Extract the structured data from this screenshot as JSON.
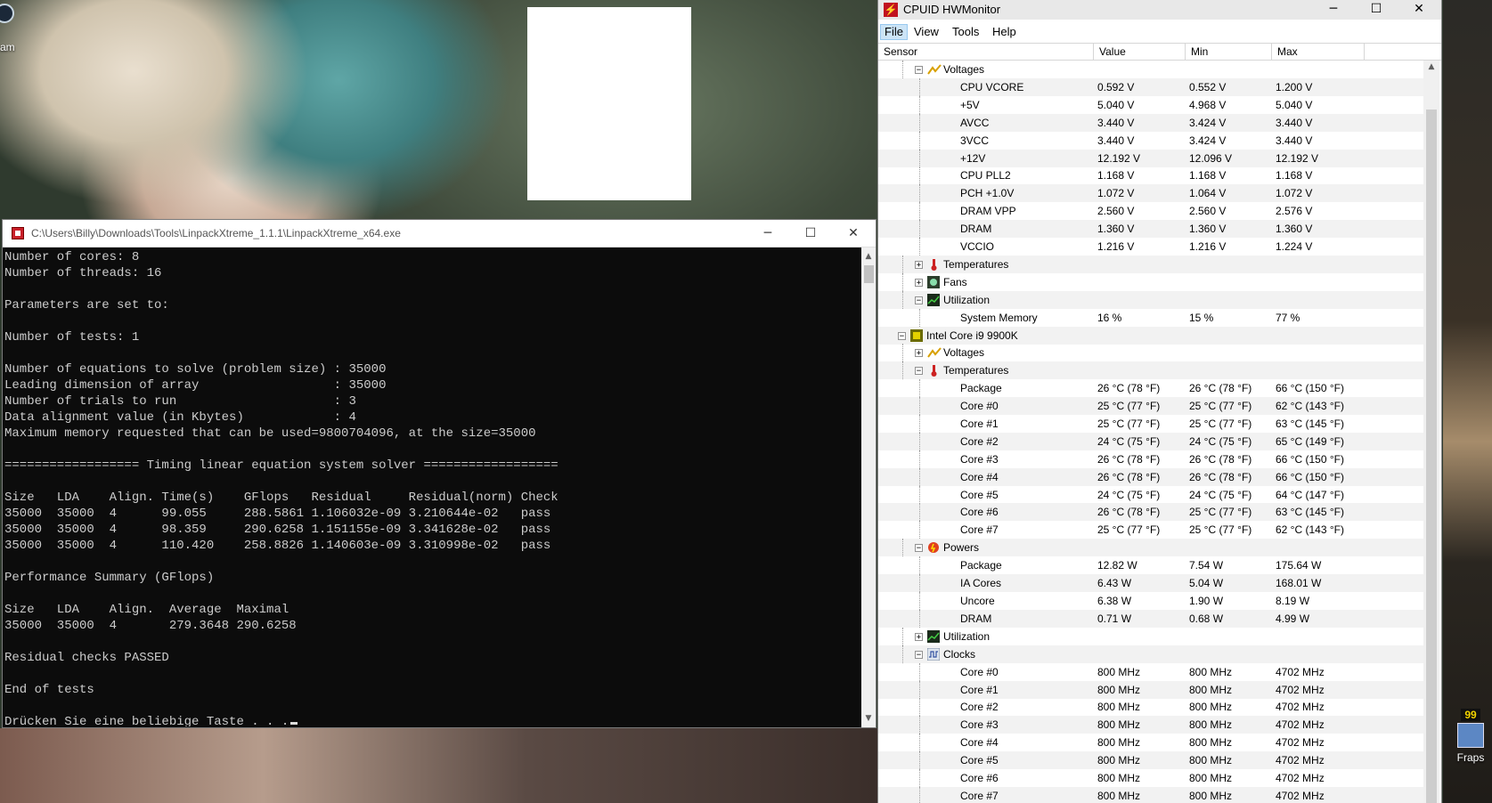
{
  "desktop": {
    "steam_label": "am",
    "fraps_label": "Fraps",
    "fraps_badge": "99"
  },
  "console": {
    "title": "C:\\Users\\Billy\\Downloads\\Tools\\LinpackXtreme_1.1.1\\LinpackXtreme_x64.exe",
    "lines": [
      "Number of cores: 8",
      "Number of threads: 16",
      "",
      "Parameters are set to:",
      "",
      "Number of tests: 1",
      "",
      "Number of equations to solve (problem size) : 35000",
      "Leading dimension of array                  : 35000",
      "Number of trials to run                     : 3",
      "Data alignment value (in Kbytes)            : 4",
      "Maximum memory requested that can be used=9800704096, at the size=35000",
      "",
      "================== Timing linear equation system solver ==================",
      "",
      "Size   LDA    Align. Time(s)    GFlops   Residual     Residual(norm) Check",
      "35000  35000  4      99.055     288.5861 1.106032e-09 3.210644e-02   pass",
      "35000  35000  4      98.359     290.6258 1.151155e-09 3.341628e-02   pass",
      "35000  35000  4      110.420    258.8826 1.140603e-09 3.310998e-02   pass",
      "",
      "Performance Summary (GFlops)",
      "",
      "Size   LDA    Align.  Average  Maximal",
      "35000  35000  4       279.3648 290.6258",
      "",
      "Residual checks PASSED",
      "",
      "End of tests",
      "",
      "Drücken Sie eine beliebige Taste . . ."
    ]
  },
  "hwmonitor": {
    "title": "CPUID HWMonitor",
    "menu": [
      "File",
      "View",
      "Tools",
      "Help"
    ],
    "columns": [
      "Sensor",
      "Value",
      "Min",
      "Max"
    ],
    "rows": [
      {
        "label": "Voltages",
        "icon": "voltage-icon",
        "toggle": "−",
        "level": 1
      },
      {
        "label": "CPU VCORE",
        "value": "0.592 V",
        "min": "0.552 V",
        "max": "1.200 V",
        "level": 2
      },
      {
        "label": "+5V",
        "value": "5.040 V",
        "min": "4.968 V",
        "max": "5.040 V",
        "level": 2
      },
      {
        "label": "AVCC",
        "value": "3.440 V",
        "min": "3.424 V",
        "max": "3.440 V",
        "level": 2
      },
      {
        "label": "3VCC",
        "value": "3.440 V",
        "min": "3.424 V",
        "max": "3.440 V",
        "level": 2
      },
      {
        "label": "+12V",
        "value": "12.192 V",
        "min": "12.096 V",
        "max": "12.192 V",
        "level": 2
      },
      {
        "label": "CPU PLL2",
        "value": "1.168 V",
        "min": "1.168 V",
        "max": "1.168 V",
        "level": 2
      },
      {
        "label": "PCH +1.0V",
        "value": "1.072 V",
        "min": "1.064 V",
        "max": "1.072 V",
        "level": 2
      },
      {
        "label": "DRAM VPP",
        "value": "2.560 V",
        "min": "2.560 V",
        "max": "2.576 V",
        "level": 2
      },
      {
        "label": "DRAM",
        "value": "1.360 V",
        "min": "1.360 V",
        "max": "1.360 V",
        "level": 2
      },
      {
        "label": "VCCIO",
        "value": "1.216 V",
        "min": "1.216 V",
        "max": "1.224 V",
        "level": 2
      },
      {
        "label": "Temperatures",
        "icon": "thermometer-icon",
        "toggle": "+",
        "level": 1
      },
      {
        "label": "Fans",
        "icon": "fan-icon",
        "toggle": "+",
        "level": 1
      },
      {
        "label": "Utilization",
        "icon": "utilization-icon",
        "toggle": "−",
        "level": 1
      },
      {
        "label": "System Memory",
        "value": "16 %",
        "min": "15 %",
        "max": "77 %",
        "level": 2
      },
      {
        "label": "Intel Core i9 9900K",
        "icon": "cpu-chip-icon",
        "toggle": "−",
        "level": 0
      },
      {
        "label": "Voltages",
        "icon": "voltage-icon",
        "toggle": "+",
        "level": 1
      },
      {
        "label": "Temperatures",
        "icon": "thermometer-icon",
        "toggle": "−",
        "level": 1
      },
      {
        "label": "Package",
        "value": "26 °C  (78 °F)",
        "min": "26 °C  (78 °F)",
        "max": "66 °C  (150 °F)",
        "level": 2
      },
      {
        "label": "Core #0",
        "value": "25 °C  (77 °F)",
        "min": "25 °C  (77 °F)",
        "max": "62 °C  (143 °F)",
        "level": 2
      },
      {
        "label": "Core #1",
        "value": "25 °C  (77 °F)",
        "min": "25 °C  (77 °F)",
        "max": "63 °C  (145 °F)",
        "level": 2
      },
      {
        "label": "Core #2",
        "value": "24 °C  (75 °F)",
        "min": "24 °C  (75 °F)",
        "max": "65 °C  (149 °F)",
        "level": 2
      },
      {
        "label": "Core #3",
        "value": "26 °C  (78 °F)",
        "min": "26 °C  (78 °F)",
        "max": "66 °C  (150 °F)",
        "level": 2
      },
      {
        "label": "Core #4",
        "value": "26 °C  (78 °F)",
        "min": "26 °C  (78 °F)",
        "max": "66 °C  (150 °F)",
        "level": 2
      },
      {
        "label": "Core #5",
        "value": "24 °C  (75 °F)",
        "min": "24 °C  (75 °F)",
        "max": "64 °C  (147 °F)",
        "level": 2
      },
      {
        "label": "Core #6",
        "value": "26 °C  (78 °F)",
        "min": "25 °C  (77 °F)",
        "max": "63 °C  (145 °F)",
        "level": 2
      },
      {
        "label": "Core #7",
        "value": "25 °C  (77 °F)",
        "min": "25 °C  (77 °F)",
        "max": "62 °C  (143 °F)",
        "level": 2
      },
      {
        "label": "Powers",
        "icon": "power-icon",
        "toggle": "−",
        "level": 1
      },
      {
        "label": "Package",
        "value": "12.82 W",
        "min": "7.54 W",
        "max": "175.64 W",
        "level": 2
      },
      {
        "label": "IA Cores",
        "value": "6.43 W",
        "min": "5.04 W",
        "max": "168.01 W",
        "level": 2
      },
      {
        "label": "Uncore",
        "value": "6.38 W",
        "min": "1.90 W",
        "max": "8.19 W",
        "level": 2
      },
      {
        "label": "DRAM",
        "value": "0.71 W",
        "min": "0.68 W",
        "max": "4.99 W",
        "level": 2
      },
      {
        "label": "Utilization",
        "icon": "utilization-icon",
        "toggle": "+",
        "level": 1
      },
      {
        "label": "Clocks",
        "icon": "clock-wave-icon",
        "toggle": "−",
        "level": 1
      },
      {
        "label": "Core #0",
        "value": "800 MHz",
        "min": "800 MHz",
        "max": "4702 MHz",
        "level": 2
      },
      {
        "label": "Core #1",
        "value": "800 MHz",
        "min": "800 MHz",
        "max": "4702 MHz",
        "level": 2
      },
      {
        "label": "Core #2",
        "value": "800 MHz",
        "min": "800 MHz",
        "max": "4702 MHz",
        "level": 2
      },
      {
        "label": "Core #3",
        "value": "800 MHz",
        "min": "800 MHz",
        "max": "4702 MHz",
        "level": 2
      },
      {
        "label": "Core #4",
        "value": "800 MHz",
        "min": "800 MHz",
        "max": "4702 MHz",
        "level": 2
      },
      {
        "label": "Core #5",
        "value": "800 MHz",
        "min": "800 MHz",
        "max": "4702 MHz",
        "level": 2
      },
      {
        "label": "Core #6",
        "value": "800 MHz",
        "min": "800 MHz",
        "max": "4702 MHz",
        "level": 2
      },
      {
        "label": "Core #7",
        "value": "800 MHz",
        "min": "800 MHz",
        "max": "4702 MHz",
        "level": 2
      }
    ]
  },
  "colors": {
    "console_bg": "#0c0c0c",
    "console_fg": "#cccccc",
    "hwm_alt_row": "#f2f2f2",
    "menu_active": "#cce4f7"
  }
}
